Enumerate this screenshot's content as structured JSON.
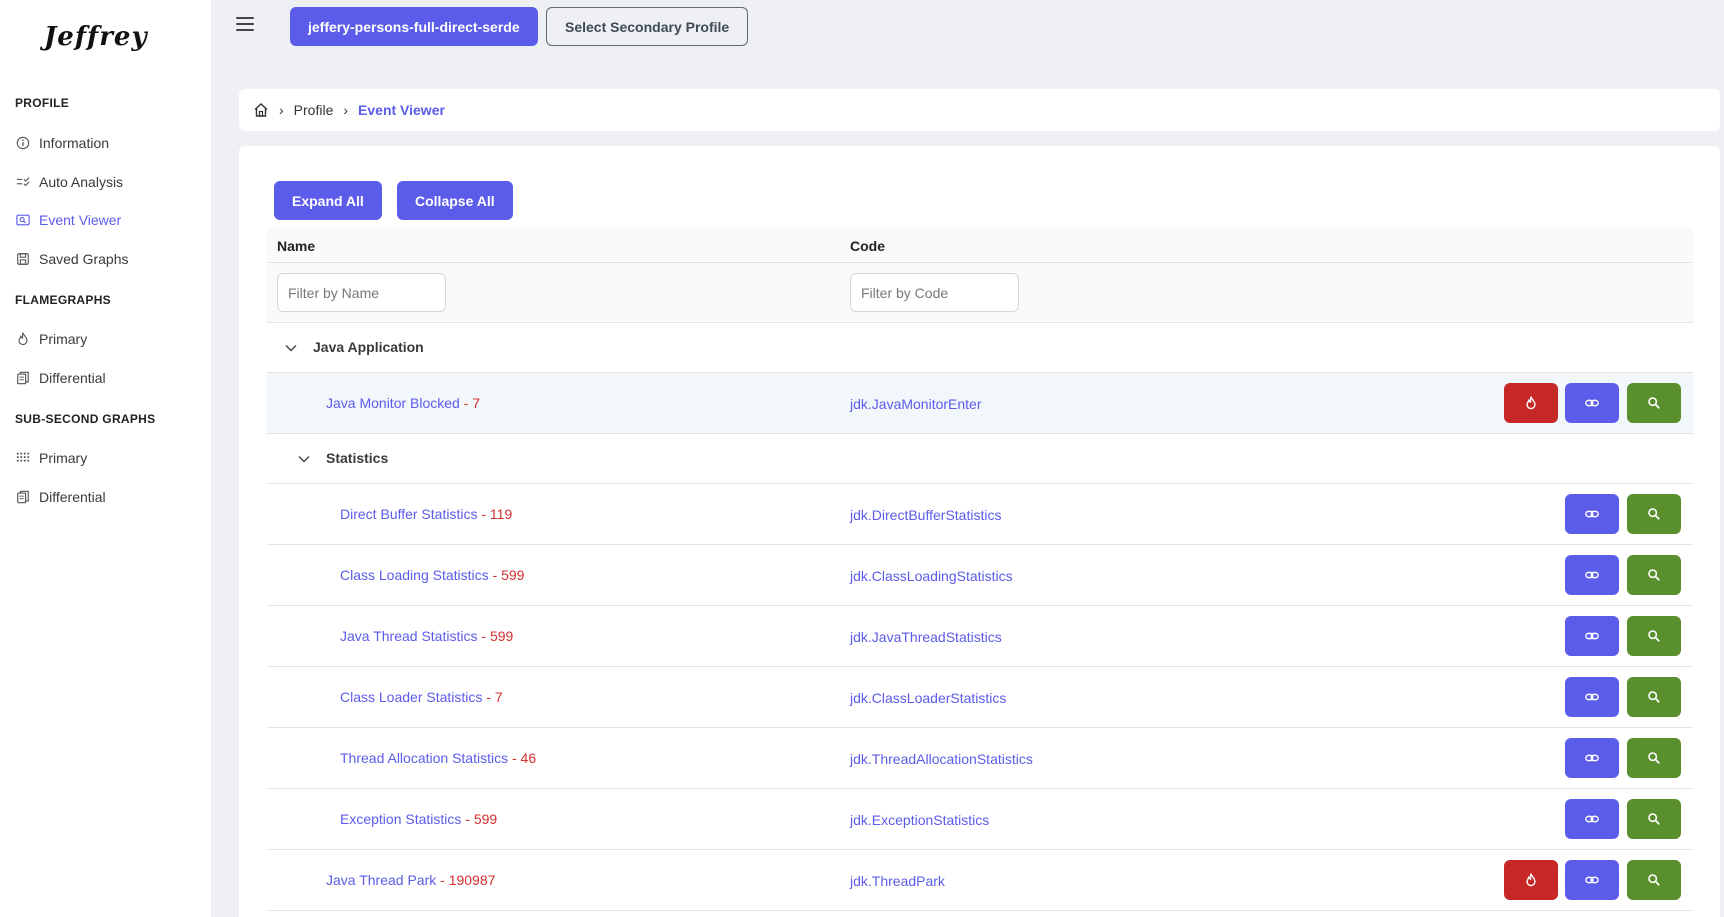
{
  "app": {
    "logo": "Jeffrey"
  },
  "sidebar": {
    "sections": [
      {
        "title": "PROFILE",
        "items": [
          {
            "label": "Information",
            "icon": "info-icon"
          },
          {
            "label": "Auto Analysis",
            "icon": "checklist-icon"
          },
          {
            "label": "Event Viewer",
            "icon": "search-list-icon",
            "active": true
          },
          {
            "label": "Saved Graphs",
            "icon": "save-icon"
          }
        ]
      },
      {
        "title": "FLAMEGRAPHS",
        "items": [
          {
            "label": "Primary",
            "icon": "fire-icon"
          },
          {
            "label": "Differential",
            "icon": "files-icon"
          }
        ]
      },
      {
        "title": "SUB-SECOND GRAPHS",
        "items": [
          {
            "label": "Primary",
            "icon": "grid-icon"
          },
          {
            "label": "Differential",
            "icon": "files-icon"
          }
        ]
      }
    ]
  },
  "header": {
    "primary_profile": "jeffery-persons-full-direct-serde",
    "secondary_profile": "Select Secondary Profile"
  },
  "breadcrumb": {
    "items": [
      "Profile",
      "Event Viewer"
    ]
  },
  "toolbar": {
    "expand_all": "Expand All",
    "collapse_all": "Collapse All"
  },
  "table": {
    "columns": {
      "name": "Name",
      "code": "Code"
    },
    "filters": {
      "name_placeholder": "Filter by Name",
      "code_placeholder": "Filter by Code"
    },
    "groups": {
      "java_application": "Java Application",
      "statistics": "Statistics"
    },
    "rows": [
      {
        "name": "Java Monitor Blocked",
        "count": "7",
        "code": "jdk.JavaMonitorEnter",
        "flame": true
      },
      {
        "name": "Direct Buffer Statistics",
        "count": "119",
        "code": "jdk.DirectBufferStatistics",
        "flame": false
      },
      {
        "name": "Class Loading Statistics",
        "count": "599",
        "code": "jdk.ClassLoadingStatistics",
        "flame": false
      },
      {
        "name": "Java Thread Statistics",
        "count": "599",
        "code": "jdk.JavaThreadStatistics",
        "flame": false
      },
      {
        "name": "Class Loader Statistics",
        "count": "7",
        "code": "jdk.ClassLoaderStatistics",
        "flame": false
      },
      {
        "name": "Thread Allocation Statistics",
        "count": "46",
        "code": "jdk.ThreadAllocationStatistics",
        "flame": false
      },
      {
        "name": "Exception Statistics",
        "count": "599",
        "code": "jdk.ExceptionStatistics",
        "flame": false
      },
      {
        "name": "Java Thread Park",
        "count": "190987",
        "code": "jdk.ThreadPark",
        "flame": true
      }
    ],
    "separator": " - "
  },
  "colors": {
    "accent": "#5b5ce9",
    "danger": "#c62828",
    "success": "#5a8f2e",
    "count": "#d32f2f"
  }
}
